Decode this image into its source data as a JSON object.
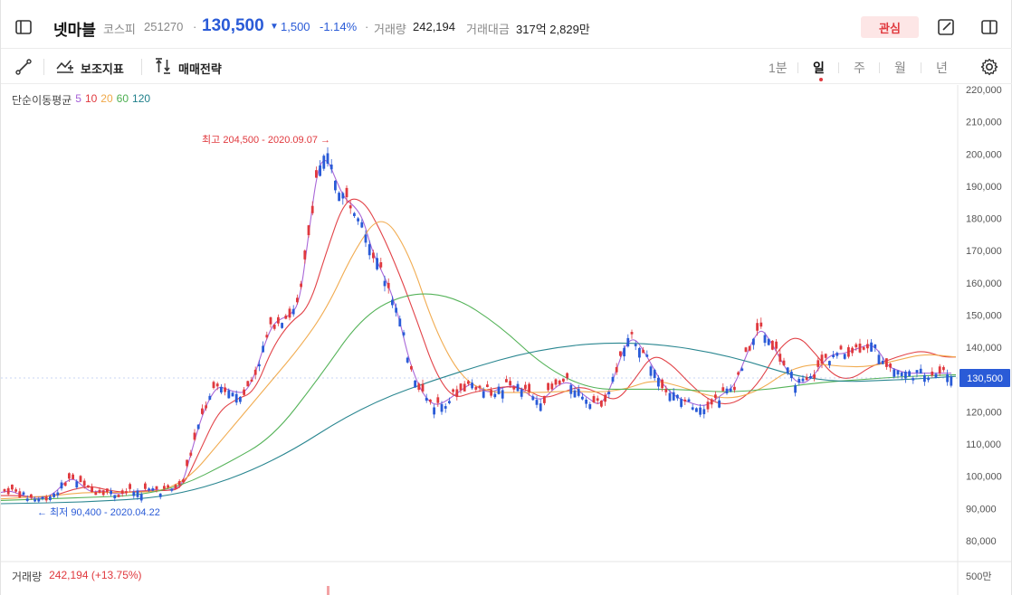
{
  "header": {
    "stock_name": "넷마블",
    "market": "코스피",
    "code": "251270",
    "sep": "·",
    "price": "130,500",
    "change_arrow": "▼",
    "change": "1,500",
    "change_rate": "-1.14%",
    "volume_label": "거래량",
    "volume_value": "242,194",
    "amount_label": "거래대금",
    "amount_value": "317억 2,829만",
    "watch_label": "관심"
  },
  "toolbar": {
    "indicator_label": "보조지표",
    "strategy_label": "매매전략",
    "periods": [
      "1분",
      "일",
      "주",
      "월",
      "년"
    ],
    "active_period": "일"
  },
  "icons": {
    "sidebar": "sidebar-icon",
    "edit": "edit-icon",
    "panel": "panel-icon",
    "draw": "draw-line-icon",
    "indicator": "indicator-chart-icon",
    "strategy": "buy-sell-icon",
    "settings": "gear-icon"
  },
  "colors": {
    "up": "#e0393e",
    "down": "#2a5bd7",
    "ma5": "#a45fd6",
    "ma10": "#e0393e",
    "ma20": "#f0a848",
    "ma60": "#4caf50",
    "ma120": "#1e7f8a",
    "price_badge": "#2a5bd7"
  },
  "ma_legend": {
    "label": "단순이동평균",
    "periods": [
      "5",
      "10",
      "20",
      "60",
      "120"
    ]
  },
  "volume_legend": {
    "label": "거래량",
    "value": "242,194 (+13.75%)"
  },
  "chart_data": {
    "type": "line",
    "price_range": [
      75000,
      222000
    ],
    "y_ticks": [
      "220,000",
      "210,000",
      "200,000",
      "190,000",
      "180,000",
      "170,000",
      "160,000",
      "150,000",
      "140,000",
      "130,000",
      "120,000",
      "110,000",
      "100,000",
      "90,000",
      "80,000"
    ],
    "y_tick_values": [
      220000,
      210000,
      200000,
      190000,
      180000,
      170000,
      160000,
      150000,
      140000,
      130000,
      120000,
      110000,
      100000,
      90000,
      80000
    ],
    "current_price_label": "130,500",
    "current_price_value": 130500,
    "high_annotation": "최고 204,500 - 2020.09.07 →",
    "high_value": 204500,
    "low_annotation": "← 최저 90,400 - 2020.04.22",
    "low_value": 90400,
    "volume_axis_label": "500만",
    "series": [
      {
        "name": "5",
        "x": [
          0,
          10,
          20,
          30,
          40,
          50,
          60,
          70,
          80,
          90,
          100,
          110,
          120,
          130,
          140,
          150,
          160,
          170,
          180,
          190,
          200,
          210,
          220,
          230,
          240,
          250,
          260,
          270,
          280,
          290,
          300,
          310,
          320,
          330,
          340,
          350,
          360,
          370,
          380,
          390,
          400,
          410,
          420,
          430,
          440,
          450,
          460,
          470,
          480,
          490,
          500,
          510,
          520,
          530,
          540,
          550,
          560,
          570,
          580,
          590,
          600,
          610,
          620,
          630,
          640,
          650,
          660,
          670,
          680,
          690,
          700,
          710,
          720,
          730,
          740,
          750,
          760,
          770,
          780,
          790,
          800,
          810,
          820,
          830,
          840,
          850,
          860,
          870,
          880,
          890,
          900,
          910,
          920,
          930,
          940,
          950,
          960,
          970,
          980,
          990,
          1000,
          1010,
          1020,
          1030,
          1040,
          1050
        ],
        "values": [
          95000,
          95500,
          94500,
          93500,
          93000,
          93500,
          95000,
          98000,
          99500,
          97000,
          95000,
          95500,
          95000,
          94500,
          95000,
          95500,
          95500,
          96000,
          95500,
          96000,
          97000,
          107000,
          117000,
          124000,
          128000,
          127000,
          126000,
          126000,
          131000,
          140000,
          147000,
          149000,
          150000,
          154000,
          175000,
          196000,
          199000,
          192000,
          186000,
          184000,
          180000,
          170000,
          164000,
          158000,
          149000,
          137000,
          129000,
          124000,
          122000,
          123000,
          125000,
          127000,
          129000,
          127000,
          126000,
          127000,
          128000,
          128000,
          126000,
          124000,
          124000,
          127000,
          129000,
          129000,
          126000,
          124000,
          122000,
          125000,
          133000,
          141000,
          143000,
          139000,
          134000,
          129000,
          126000,
          124000,
          123000,
          122000,
          122000,
          124000,
          126000,
          128000,
          135000,
          142000,
          146000,
          142000,
          137000,
          132000,
          129000,
          129000,
          132000,
          136000,
          138000,
          138000,
          139000,
          140000,
          141000,
          139000,
          134000,
          133000,
          132000,
          132000,
          132000,
          132000,
          132000,
          132000
        ],
        "color": "#a45fd6"
      },
      {
        "name": "10",
        "x": [
          0,
          20,
          40,
          60,
          80,
          100,
          120,
          140,
          160,
          180,
          200,
          220,
          240,
          260,
          280,
          300,
          320,
          340,
          360,
          380,
          400,
          420,
          440,
          460,
          480,
          500,
          520,
          540,
          560,
          580,
          600,
          620,
          640,
          660,
          680,
          700,
          720,
          740,
          760,
          780,
          800,
          820,
          840,
          860,
          880,
          900,
          920,
          940,
          960,
          980,
          1000,
          1020,
          1040,
          1055
        ],
        "values": [
          94000,
          94000,
          93500,
          94000,
          96000,
          97000,
          95500,
          95000,
          95500,
          95500,
          96000,
          108000,
          120000,
          124000,
          126000,
          140000,
          148000,
          152000,
          170000,
          186000,
          186000,
          176000,
          163000,
          148000,
          132000,
          124000,
          126000,
          127000,
          128000,
          127000,
          124000,
          126000,
          128000,
          126000,
          123000,
          130000,
          138000,
          135000,
          129000,
          124000,
          122000,
          124000,
          130000,
          140000,
          144000,
          138000,
          131000,
          130000,
          134000,
          136000,
          138000,
          139000,
          137000,
          137000
        ],
        "color": "#e0393e"
      },
      {
        "name": "20",
        "x": [
          0,
          30,
          60,
          90,
          120,
          150,
          180,
          210,
          240,
          270,
          300,
          330,
          360,
          390,
          420,
          450,
          480,
          510,
          540,
          570,
          600,
          630,
          660,
          690,
          720,
          750,
          780,
          810,
          840,
          870,
          900,
          930,
          960,
          990,
          1020,
          1055
        ],
        "values": [
          93000,
          93500,
          94000,
          95000,
          95000,
          95000,
          95500,
          100000,
          110000,
          120000,
          130000,
          140000,
          152000,
          170000,
          182000,
          170000,
          145000,
          130000,
          126000,
          126000,
          126000,
          126500,
          126000,
          127000,
          130000,
          128000,
          125000,
          124000,
          127000,
          133000,
          135000,
          134000,
          134000,
          136000,
          138000,
          137000
        ],
        "color": "#f0a848"
      },
      {
        "name": "60",
        "x": [
          0,
          50,
          100,
          150,
          200,
          250,
          300,
          350,
          400,
          450,
          500,
          550,
          600,
          650,
          700,
          750,
          800,
          850,
          900,
          950,
          1000,
          1055
        ],
        "values": [
          92500,
          93000,
          93500,
          94000,
          97000,
          104000,
          112000,
          130000,
          150000,
          157000,
          156000,
          147000,
          134000,
          127000,
          127000,
          127000,
          126000,
          127000,
          129000,
          130000,
          131000,
          131500
        ],
        "color": "#4caf50"
      },
      {
        "name": "120",
        "x": [
          0,
          100,
          200,
          300,
          400,
          500,
          600,
          700,
          800,
          900,
          1000,
          1055
        ],
        "values": [
          91500,
          92000,
          94000,
          104000,
          122000,
          132000,
          140000,
          142000,
          138000,
          129000,
          130000,
          131000
        ],
        "color": "#1e7f8a"
      }
    ],
    "grid": true,
    "legend": "top-left"
  }
}
